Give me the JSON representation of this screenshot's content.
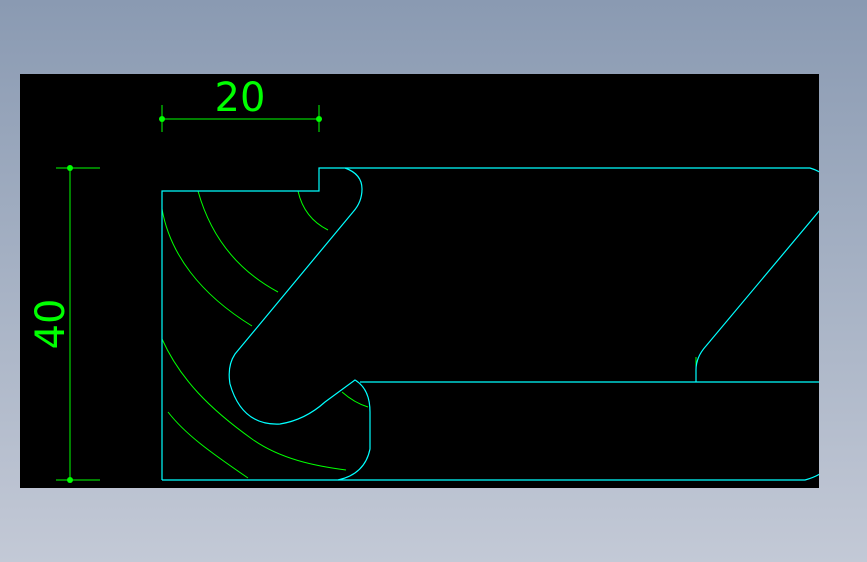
{
  "colors": {
    "background": "#000000",
    "outline": "#00ffff",
    "dimension": "#00ff00",
    "hatch": "#00ff00"
  },
  "dimensions": {
    "width_value": "20",
    "height_value": "40"
  }
}
